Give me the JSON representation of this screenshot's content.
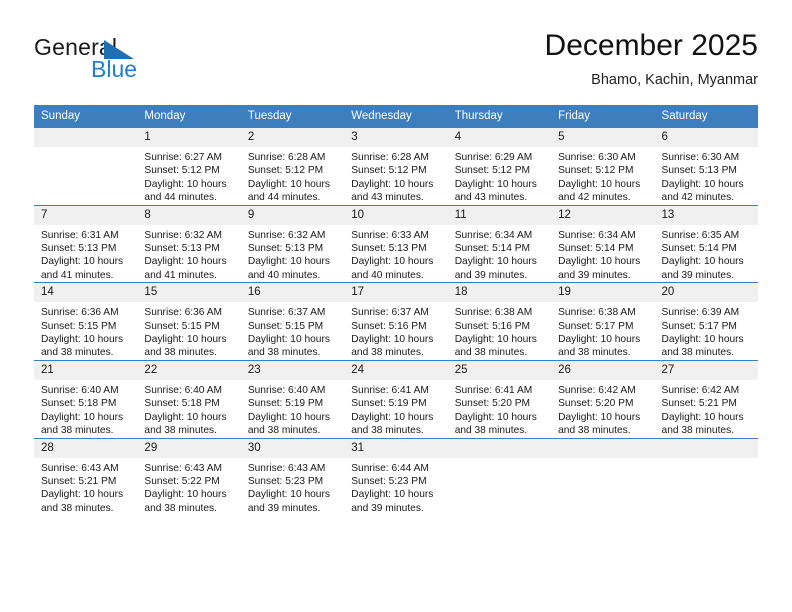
{
  "brand": {
    "name_top": "General",
    "name_bottom": "Blue",
    "triangle_color": "#1f6fb2",
    "blue_color": "#1f7fd0"
  },
  "header": {
    "title": "December 2025",
    "subtitle": "Bhamo, Kachin, Myanmar"
  },
  "colors": {
    "header_row": "#3c7ebe",
    "daynum_band": "#f0f0f0",
    "cell_background": "#ffffff",
    "text": "#1a1a1a"
  },
  "weekday_headers": [
    "Sunday",
    "Monday",
    "Tuesday",
    "Wednesday",
    "Thursday",
    "Friday",
    "Saturday"
  ],
  "weeks": [
    [
      {
        "day": "",
        "lines": []
      },
      {
        "day": "1",
        "lines": [
          "Sunrise: 6:27 AM",
          "Sunset: 5:12 PM",
          "Daylight: 10 hours",
          "and 44 minutes."
        ]
      },
      {
        "day": "2",
        "lines": [
          "Sunrise: 6:28 AM",
          "Sunset: 5:12 PM",
          "Daylight: 10 hours",
          "and 44 minutes."
        ]
      },
      {
        "day": "3",
        "lines": [
          "Sunrise: 6:28 AM",
          "Sunset: 5:12 PM",
          "Daylight: 10 hours",
          "and 43 minutes."
        ]
      },
      {
        "day": "4",
        "lines": [
          "Sunrise: 6:29 AM",
          "Sunset: 5:12 PM",
          "Daylight: 10 hours",
          "and 43 minutes."
        ]
      },
      {
        "day": "5",
        "lines": [
          "Sunrise: 6:30 AM",
          "Sunset: 5:12 PM",
          "Daylight: 10 hours",
          "and 42 minutes."
        ]
      },
      {
        "day": "6",
        "lines": [
          "Sunrise: 6:30 AM",
          "Sunset: 5:13 PM",
          "Daylight: 10 hours",
          "and 42 minutes."
        ]
      }
    ],
    [
      {
        "day": "7",
        "lines": [
          "Sunrise: 6:31 AM",
          "Sunset: 5:13 PM",
          "Daylight: 10 hours",
          "and 41 minutes."
        ]
      },
      {
        "day": "8",
        "lines": [
          "Sunrise: 6:32 AM",
          "Sunset: 5:13 PM",
          "Daylight: 10 hours",
          "and 41 minutes."
        ]
      },
      {
        "day": "9",
        "lines": [
          "Sunrise: 6:32 AM",
          "Sunset: 5:13 PM",
          "Daylight: 10 hours",
          "and 40 minutes."
        ]
      },
      {
        "day": "10",
        "lines": [
          "Sunrise: 6:33 AM",
          "Sunset: 5:13 PM",
          "Daylight: 10 hours",
          "and 40 minutes."
        ]
      },
      {
        "day": "11",
        "lines": [
          "Sunrise: 6:34 AM",
          "Sunset: 5:14 PM",
          "Daylight: 10 hours",
          "and 39 minutes."
        ]
      },
      {
        "day": "12",
        "lines": [
          "Sunrise: 6:34 AM",
          "Sunset: 5:14 PM",
          "Daylight: 10 hours",
          "and 39 minutes."
        ]
      },
      {
        "day": "13",
        "lines": [
          "Sunrise: 6:35 AM",
          "Sunset: 5:14 PM",
          "Daylight: 10 hours",
          "and 39 minutes."
        ]
      }
    ],
    [
      {
        "day": "14",
        "lines": [
          "Sunrise: 6:36 AM",
          "Sunset: 5:15 PM",
          "Daylight: 10 hours",
          "and 38 minutes."
        ]
      },
      {
        "day": "15",
        "lines": [
          "Sunrise: 6:36 AM",
          "Sunset: 5:15 PM",
          "Daylight: 10 hours",
          "and 38 minutes."
        ]
      },
      {
        "day": "16",
        "lines": [
          "Sunrise: 6:37 AM",
          "Sunset: 5:15 PM",
          "Daylight: 10 hours",
          "and 38 minutes."
        ]
      },
      {
        "day": "17",
        "lines": [
          "Sunrise: 6:37 AM",
          "Sunset: 5:16 PM",
          "Daylight: 10 hours",
          "and 38 minutes."
        ]
      },
      {
        "day": "18",
        "lines": [
          "Sunrise: 6:38 AM",
          "Sunset: 5:16 PM",
          "Daylight: 10 hours",
          "and 38 minutes."
        ]
      },
      {
        "day": "19",
        "lines": [
          "Sunrise: 6:38 AM",
          "Sunset: 5:17 PM",
          "Daylight: 10 hours",
          "and 38 minutes."
        ]
      },
      {
        "day": "20",
        "lines": [
          "Sunrise: 6:39 AM",
          "Sunset: 5:17 PM",
          "Daylight: 10 hours",
          "and 38 minutes."
        ]
      }
    ],
    [
      {
        "day": "21",
        "lines": [
          "Sunrise: 6:40 AM",
          "Sunset: 5:18 PM",
          "Daylight: 10 hours",
          "and 38 minutes."
        ]
      },
      {
        "day": "22",
        "lines": [
          "Sunrise: 6:40 AM",
          "Sunset: 5:18 PM",
          "Daylight: 10 hours",
          "and 38 minutes."
        ]
      },
      {
        "day": "23",
        "lines": [
          "Sunrise: 6:40 AM",
          "Sunset: 5:19 PM",
          "Daylight: 10 hours",
          "and 38 minutes."
        ]
      },
      {
        "day": "24",
        "lines": [
          "Sunrise: 6:41 AM",
          "Sunset: 5:19 PM",
          "Daylight: 10 hours",
          "and 38 minutes."
        ]
      },
      {
        "day": "25",
        "lines": [
          "Sunrise: 6:41 AM",
          "Sunset: 5:20 PM",
          "Daylight: 10 hours",
          "and 38 minutes."
        ]
      },
      {
        "day": "26",
        "lines": [
          "Sunrise: 6:42 AM",
          "Sunset: 5:20 PM",
          "Daylight: 10 hours",
          "and 38 minutes."
        ]
      },
      {
        "day": "27",
        "lines": [
          "Sunrise: 6:42 AM",
          "Sunset: 5:21 PM",
          "Daylight: 10 hours",
          "and 38 minutes."
        ]
      }
    ],
    [
      {
        "day": "28",
        "lines": [
          "Sunrise: 6:43 AM",
          "Sunset: 5:21 PM",
          "Daylight: 10 hours",
          "and 38 minutes."
        ]
      },
      {
        "day": "29",
        "lines": [
          "Sunrise: 6:43 AM",
          "Sunset: 5:22 PM",
          "Daylight: 10 hours",
          "and 38 minutes."
        ]
      },
      {
        "day": "30",
        "lines": [
          "Sunrise: 6:43 AM",
          "Sunset: 5:23 PM",
          "Daylight: 10 hours",
          "and 39 minutes."
        ]
      },
      {
        "day": "31",
        "lines": [
          "Sunrise: 6:44 AM",
          "Sunset: 5:23 PM",
          "Daylight: 10 hours",
          "and 39 minutes."
        ]
      },
      {
        "day": "",
        "lines": []
      },
      {
        "day": "",
        "lines": []
      },
      {
        "day": "",
        "lines": []
      }
    ]
  ]
}
